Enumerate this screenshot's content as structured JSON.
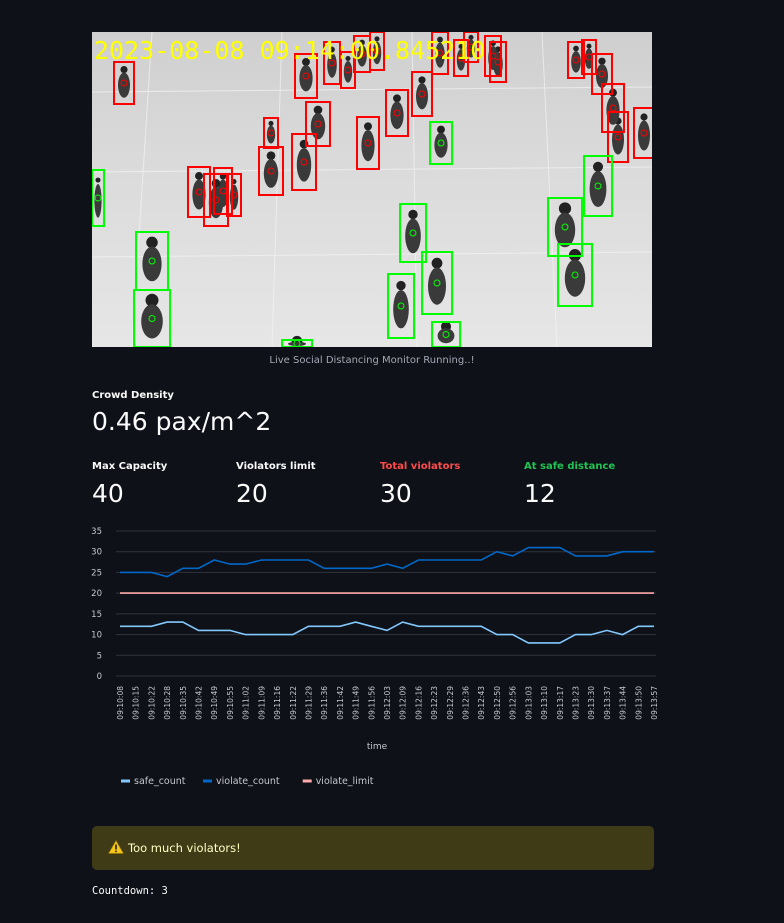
{
  "video": {
    "timestamp": "2023-08-08 09:14:00.845210",
    "caption": "Live Social Distancing Monitor Running..!",
    "violator_color": "#ff0000",
    "safe_color": "#00ff00"
  },
  "metrics": {
    "crowd_density_label": "Crowd Density",
    "crowd_density_value": "0.46 pax/m^2",
    "max_capacity_label": "Max Capacity",
    "max_capacity_value": "40",
    "violators_limit_label": "Violators limit",
    "violators_limit_value": "20",
    "total_violators_label": "Total violators",
    "total_violators_value": "30",
    "total_violators_color": "#ff4b4b",
    "safe_distance_label": "At safe distance",
    "safe_distance_value": "12",
    "safe_distance_color": "#21c354"
  },
  "chart_data": {
    "type": "line",
    "xlabel": "time",
    "ylabel": "",
    "ylim": [
      0,
      35
    ],
    "yticks": [
      0,
      5,
      10,
      15,
      20,
      25,
      30,
      35
    ],
    "grid": true,
    "legend_position": "bottom-left",
    "x": [
      "09:10:08",
      "09:10:15",
      "09:10:22",
      "09:10:28",
      "09:10:35",
      "09:10:42",
      "09:10:49",
      "09:10:55",
      "09:11:02",
      "09:11:09",
      "09:11:16",
      "09:11:22",
      "09:11:29",
      "09:11:36",
      "09:11:42",
      "09:11:49",
      "09:11:56",
      "09:12:03",
      "09:12:09",
      "09:12:16",
      "09:12:23",
      "09:12:29",
      "09:12:36",
      "09:12:43",
      "09:12:50",
      "09:12:56",
      "09:13:03",
      "09:13:10",
      "09:13:17",
      "09:13:23",
      "09:13:30",
      "09:13:37",
      "09:13:44",
      "09:13:50",
      "09:13:57"
    ],
    "series": [
      {
        "name": "safe_count",
        "color": "#83c9ff",
        "values": [
          12,
          12,
          12,
          13,
          13,
          11,
          11,
          11,
          10,
          10,
          10,
          10,
          12,
          12,
          12,
          13,
          12,
          11,
          13,
          12,
          12,
          12,
          12,
          12,
          10,
          10,
          8,
          8,
          8,
          10,
          10,
          11,
          10,
          12,
          12
        ]
      },
      {
        "name": "violate_count",
        "color": "#0068c9",
        "values": [
          25,
          25,
          25,
          24,
          26,
          26,
          28,
          27,
          27,
          28,
          28,
          28,
          28,
          26,
          26,
          26,
          26,
          27,
          26,
          28,
          28,
          28,
          28,
          28,
          30,
          29,
          31,
          31,
          31,
          29,
          29,
          29,
          30,
          30,
          30
        ]
      },
      {
        "name": "violate_limit",
        "color": "#ffabab",
        "values": [
          20,
          20,
          20,
          20,
          20,
          20,
          20,
          20,
          20,
          20,
          20,
          20,
          20,
          20,
          20,
          20,
          20,
          20,
          20,
          20,
          20,
          20,
          20,
          20,
          20,
          20,
          20,
          20,
          20,
          20,
          20,
          20,
          20,
          20,
          20
        ]
      }
    ]
  },
  "alert": {
    "icon": "warning-icon",
    "text": "Too much violators!"
  },
  "countdown": "Countdown: 3"
}
